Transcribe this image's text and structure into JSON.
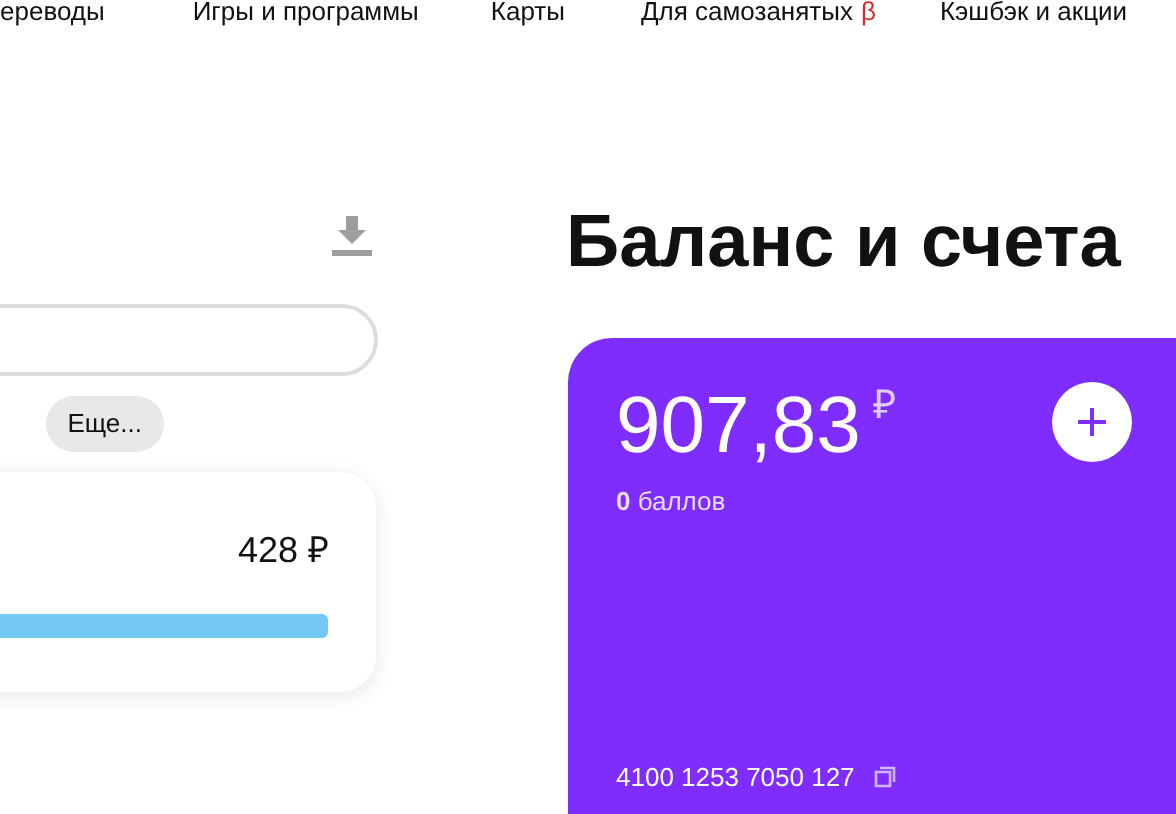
{
  "nav": [
    {
      "label": "ереводы"
    },
    {
      "label": "Игры и программы"
    },
    {
      "label": "Карты"
    },
    {
      "label": "Для самозанятых",
      "badge": "β"
    },
    {
      "label": "Кэшбэк и акции"
    }
  ],
  "filters": {
    "more_button": "Еще..."
  },
  "spending": {
    "amount": "428 ₽"
  },
  "balance": {
    "title": "Баланс и счета",
    "amount": "907,83",
    "currency": "₽",
    "points": "**0** баллов",
    "account_number": "4100 1253 7050 127"
  }
}
